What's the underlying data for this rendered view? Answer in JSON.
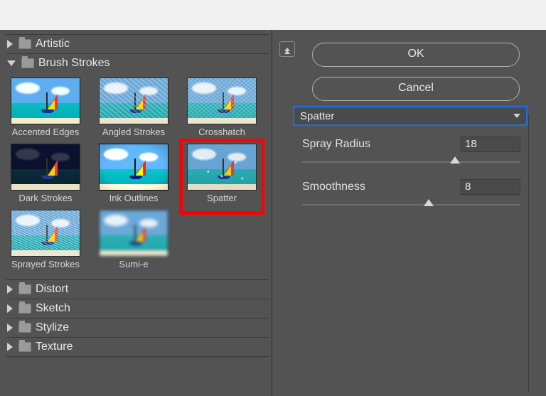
{
  "buttons": {
    "ok": "OK",
    "cancel": "Cancel"
  },
  "filter_dropdown": {
    "selected": "Spatter"
  },
  "params": [
    {
      "label": "Spray Radius",
      "value": "18",
      "pos_pct": 70
    },
    {
      "label": "Smoothness",
      "value": "8",
      "pos_pct": 58
    }
  ],
  "categories": [
    {
      "name": "Artistic",
      "expanded": false
    },
    {
      "name": "Brush Strokes",
      "expanded": true,
      "filters": [
        {
          "label": "Accented Edges",
          "variant": "accented",
          "selected": false
        },
        {
          "label": "Angled Strokes",
          "variant": "angled",
          "selected": false
        },
        {
          "label": "Crosshatch",
          "variant": "cross",
          "selected": false
        },
        {
          "label": "Dark Strokes",
          "variant": "dark",
          "selected": false
        },
        {
          "label": "Ink Outlines",
          "variant": "ink",
          "selected": false
        },
        {
          "label": "Spatter",
          "variant": "spatter",
          "selected": true
        },
        {
          "label": "Sprayed Strokes",
          "variant": "spray",
          "selected": false
        },
        {
          "label": "Sumi-e",
          "variant": "sumi",
          "selected": false
        }
      ]
    },
    {
      "name": "Distort",
      "expanded": false
    },
    {
      "name": "Sketch",
      "expanded": false
    },
    {
      "name": "Stylize",
      "expanded": false
    },
    {
      "name": "Texture",
      "expanded": false
    }
  ]
}
